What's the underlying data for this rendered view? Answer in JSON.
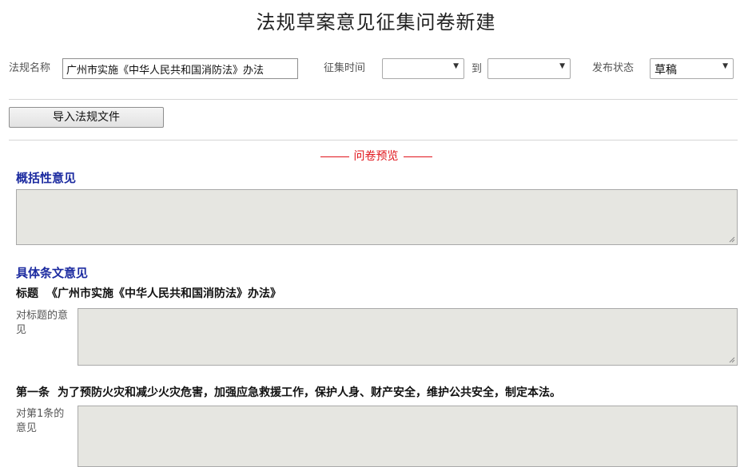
{
  "page": {
    "title": "法规草案意见征集问卷新建"
  },
  "form": {
    "name_label": "法规名称",
    "name_value": "广州市实施《中华人民共和国消防法》办法",
    "period_label": "征集时间",
    "period_start": "",
    "period_to": "到",
    "period_end": "",
    "status_label": "发布状态",
    "status_value": "草稿"
  },
  "import_button": "导入法规文件",
  "preview_label": "问卷预览",
  "general": {
    "heading": "概括性意见"
  },
  "specific": {
    "heading": "具体条文意见",
    "title_tag": "标题",
    "title_text": "《广州市实施《中华人民共和国消防法》办法》",
    "title_comment_label": "对标题的意见",
    "article1_tag": "第一条",
    "article1_text": "为了预防火灾和减少火灾危害，加强应急救援工作，保护人身、财产安全，维护公共安全，制定本法。",
    "article1_comment_label": "对第1条的意见"
  }
}
